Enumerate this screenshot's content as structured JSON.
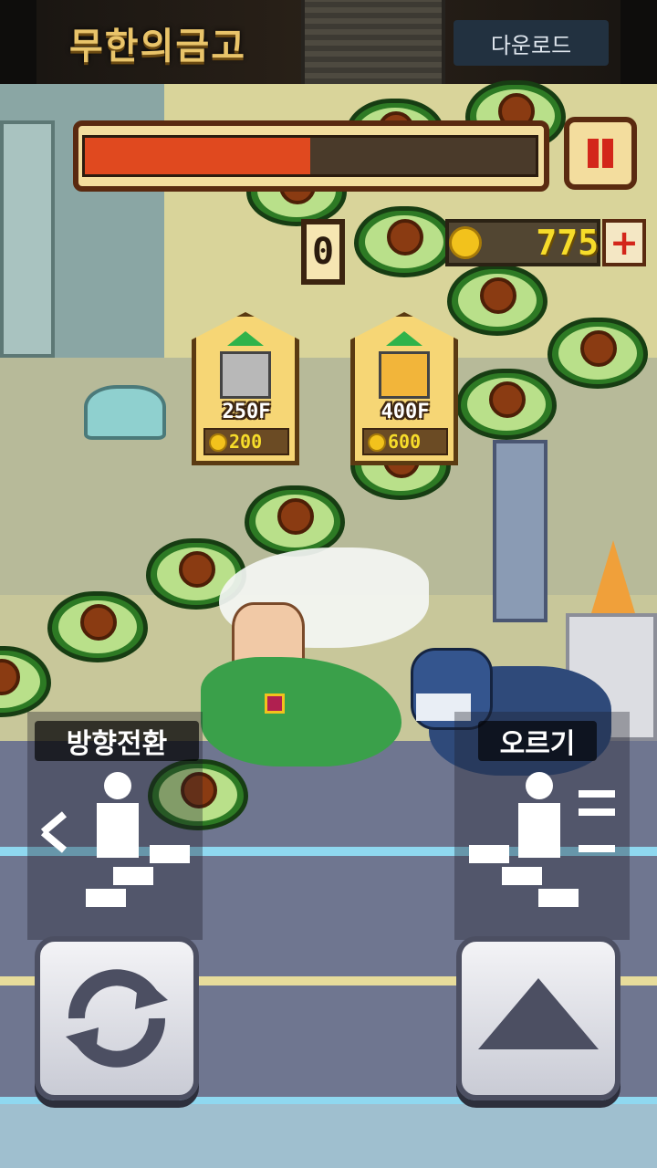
{
  "ad": {
    "title": "무한의금고",
    "download_label": "다운로드"
  },
  "hud": {
    "hp_fraction": 0.5,
    "score": "0",
    "coins": "775",
    "add_coins_label": "+"
  },
  "shop": [
    {
      "floor": "250F",
      "price": "200",
      "color": "#b8b8b8"
    },
    {
      "floor": "400F",
      "price": "600",
      "color": "#f2b53a"
    }
  ],
  "controls": {
    "turn_label": "방향전환",
    "climb_label": "오르기"
  },
  "colors": {
    "hp_fill": "#e0491f",
    "coin": "#f6dc2a",
    "accent_red": "#d3261a"
  }
}
